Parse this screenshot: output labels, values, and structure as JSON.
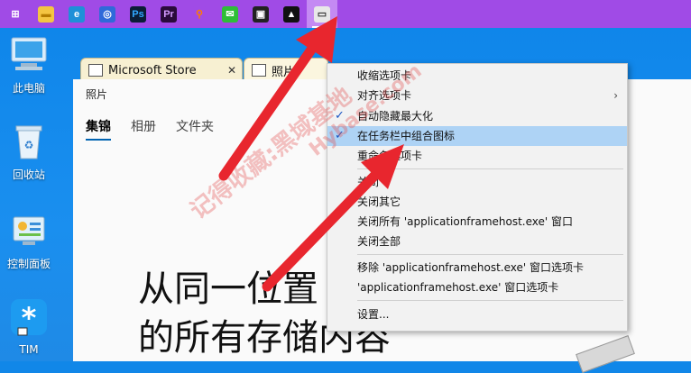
{
  "taskbar": {
    "icons": [
      {
        "name": "windows-start-icon",
        "glyph": "⊞",
        "bg": "#a04be6",
        "fg": "#ffffff"
      },
      {
        "name": "file-explorer-icon",
        "glyph": "▬",
        "bg": "#f4c542",
        "fg": "#b47c00"
      },
      {
        "name": "edge-browser-icon",
        "glyph": "e",
        "bg": "#1e90d8",
        "fg": "#ffffff"
      },
      {
        "name": "app-blue-icon",
        "glyph": "◎",
        "bg": "#2f6ad9",
        "fg": "#ffffff"
      },
      {
        "name": "photoshop-icon",
        "glyph": "Ps",
        "bg": "#0b1d36",
        "fg": "#31a8ff"
      },
      {
        "name": "premiere-icon",
        "glyph": "Pr",
        "bg": "#2a0b3a",
        "fg": "#d59bff"
      },
      {
        "name": "search-tool-icon",
        "glyph": "⚲",
        "bg": "#a04be6",
        "fg": "#ff7a00"
      },
      {
        "name": "wechat-icon",
        "glyph": "✉",
        "bg": "#2fbe38",
        "fg": "#ffffff"
      },
      {
        "name": "store-bag-icon",
        "glyph": "▣",
        "bg": "#222222",
        "fg": "#ffffff"
      },
      {
        "name": "photos-icon",
        "glyph": "▲",
        "bg": "#111111",
        "fg": "#ffffff"
      },
      {
        "name": "app-frame-icon",
        "glyph": "▭",
        "bg": "#e8e8e8",
        "fg": "#333333",
        "active": true
      }
    ]
  },
  "desktop": {
    "icons": [
      {
        "label": "此电脑"
      },
      {
        "label": "回收站"
      },
      {
        "label": "控制面板"
      },
      {
        "label": "TIM"
      }
    ]
  },
  "tabs": [
    {
      "label": "Microsoft Store",
      "close": "✕"
    },
    {
      "label": "照片"
    }
  ],
  "window": {
    "title": "照片",
    "nav": [
      "集锦",
      "相册",
      "文件夹"
    ],
    "headline_line1": "从同一位置",
    "headline_line2": "的所有存储内容"
  },
  "menu": {
    "items": [
      {
        "label": "收缩选项卡"
      },
      {
        "label": "对齐选项卡",
        "arrow": "›"
      },
      {
        "label": "自动隐藏最大化",
        "checked": "✓"
      },
      {
        "label": "在任务栏中组合图标",
        "checked": "✓",
        "highlighted": true
      },
      {
        "label": "重命名选项卡"
      },
      {
        "label": "关闭"
      },
      {
        "label": "关闭其它"
      },
      {
        "label": "关闭所有 'applicationframehost.exe' 窗口"
      },
      {
        "label": "关闭全部"
      },
      {
        "label": "移除 'applicationframehost.exe' 窗口选项卡"
      },
      {
        "label": "'applicationframehost.exe' 窗口选项卡"
      },
      {
        "label": "设置..."
      }
    ]
  },
  "watermark": {
    "line1": "记得收藏:黑域基地",
    "line2": "Hybase.com"
  },
  "colors": {
    "arrow": "#e8262e",
    "taskbar": "#a04be6"
  }
}
